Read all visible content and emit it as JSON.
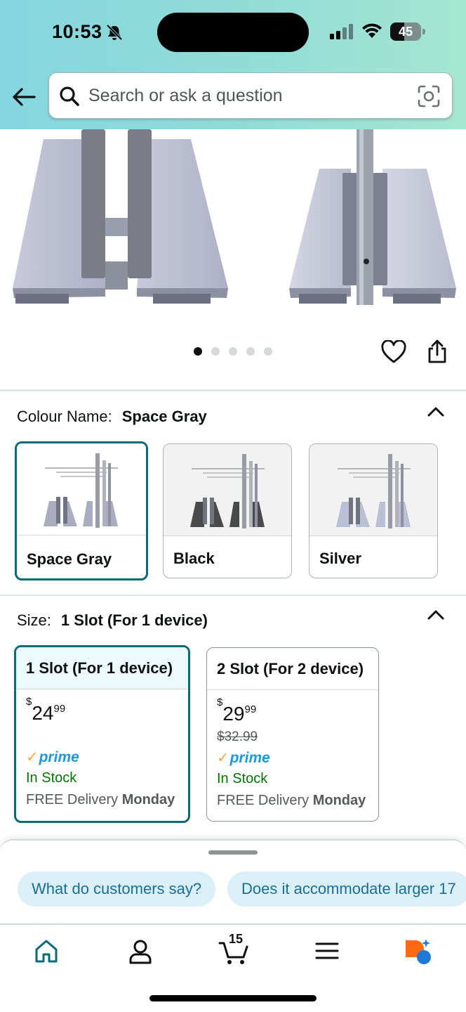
{
  "status_bar": {
    "time": "10:53",
    "battery": "45",
    "battery_level": 0.45
  },
  "search": {
    "placeholder": "Search or ask a question"
  },
  "carousel": {
    "image_count": 5,
    "active_index": 0
  },
  "colour": {
    "label": "Colour Name:",
    "selected": "Space Gray",
    "options": [
      {
        "name": "Space Gray",
        "finish": "#a9adbf"
      },
      {
        "name": "Black",
        "finish": "#4a4a4a"
      },
      {
        "name": "Silver",
        "finish": "#b9c0d6"
      }
    ]
  },
  "size": {
    "label": "Size:",
    "selected": "1 Slot (For 1 device)",
    "options": [
      {
        "name": "1 Slot (For 1 device)",
        "currency": "$",
        "price_whole": "24",
        "price_cents": "99",
        "was_price": "",
        "prime": "prime",
        "stock": "In Stock",
        "delivery_prefix": "FREE Delivery",
        "delivery_day": "Monday"
      },
      {
        "name": "2 Slot (For 2 device)",
        "currency": "$",
        "price_whole": "29",
        "price_cents": "99",
        "was_price": "$32.99",
        "prime": "prime",
        "stock": "In Stock",
        "delivery_prefix": "FREE Delivery",
        "delivery_day": "Monday"
      }
    ]
  },
  "suggestions": {
    "chips": [
      "What do customers say?",
      "Does it accommodate larger 17"
    ]
  },
  "nav": {
    "cart_count": "15",
    "items": [
      "home-icon",
      "account-icon",
      "cart-icon",
      "menu-icon",
      "rufus-icon"
    ]
  },
  "colors": {
    "accent": "#0a6a78",
    "prime_blue": "#1e98d6",
    "stock_green": "#007600",
    "chip_bg": "#dbeff7"
  }
}
